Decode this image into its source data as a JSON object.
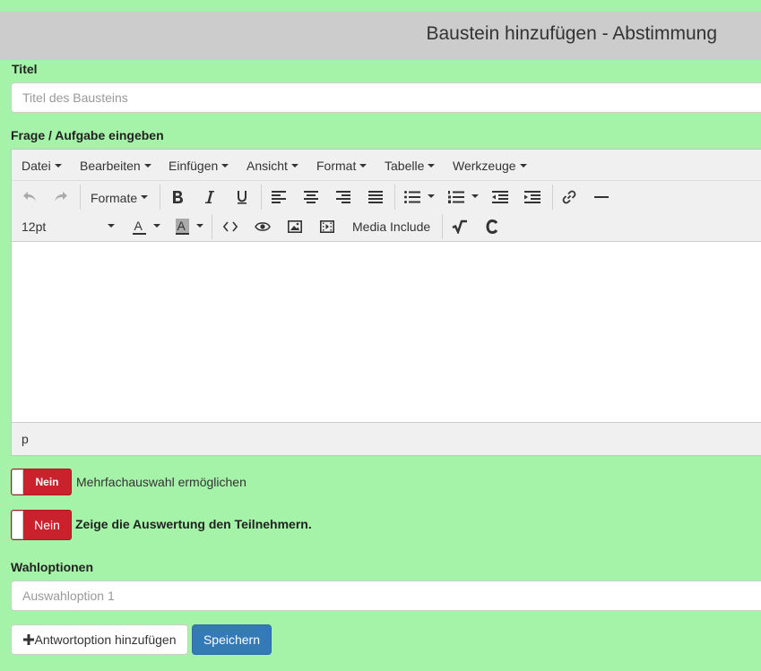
{
  "header": {
    "title": "Baustein hinzufügen - Abstimmung"
  },
  "form": {
    "title_label": "Titel",
    "title_placeholder": "Titel des Bausteins",
    "question_label": "Frage / Aufgabe eingeben",
    "options_label": "Wahloptionen",
    "option1_placeholder": "Auswahloption 1"
  },
  "editor": {
    "menus": [
      "Datei",
      "Bearbeiten",
      "Einfügen",
      "Ansicht",
      "Format",
      "Tabelle",
      "Werkzeuge"
    ],
    "formats_label": "Formate",
    "font_size": "12pt",
    "media_include_label": "Media Include",
    "font_color_letter": "A",
    "bg_color_letter": "A",
    "status_path": "p"
  },
  "toggles": {
    "multi_choice": {
      "state": "Nein",
      "label": "Mehrfachauswahl ermöglichen"
    },
    "show_results": {
      "state": "Nein",
      "label": "Zeige die Auswertung den Teilnehmern."
    }
  },
  "buttons": {
    "add_answer": "Antwortoption hinzufügen",
    "save": "Speichern"
  },
  "colors": {
    "background": "#a5f3a8",
    "header": "#cccccc",
    "toggle_off": "#c9222d",
    "primary": "#337ab7"
  }
}
